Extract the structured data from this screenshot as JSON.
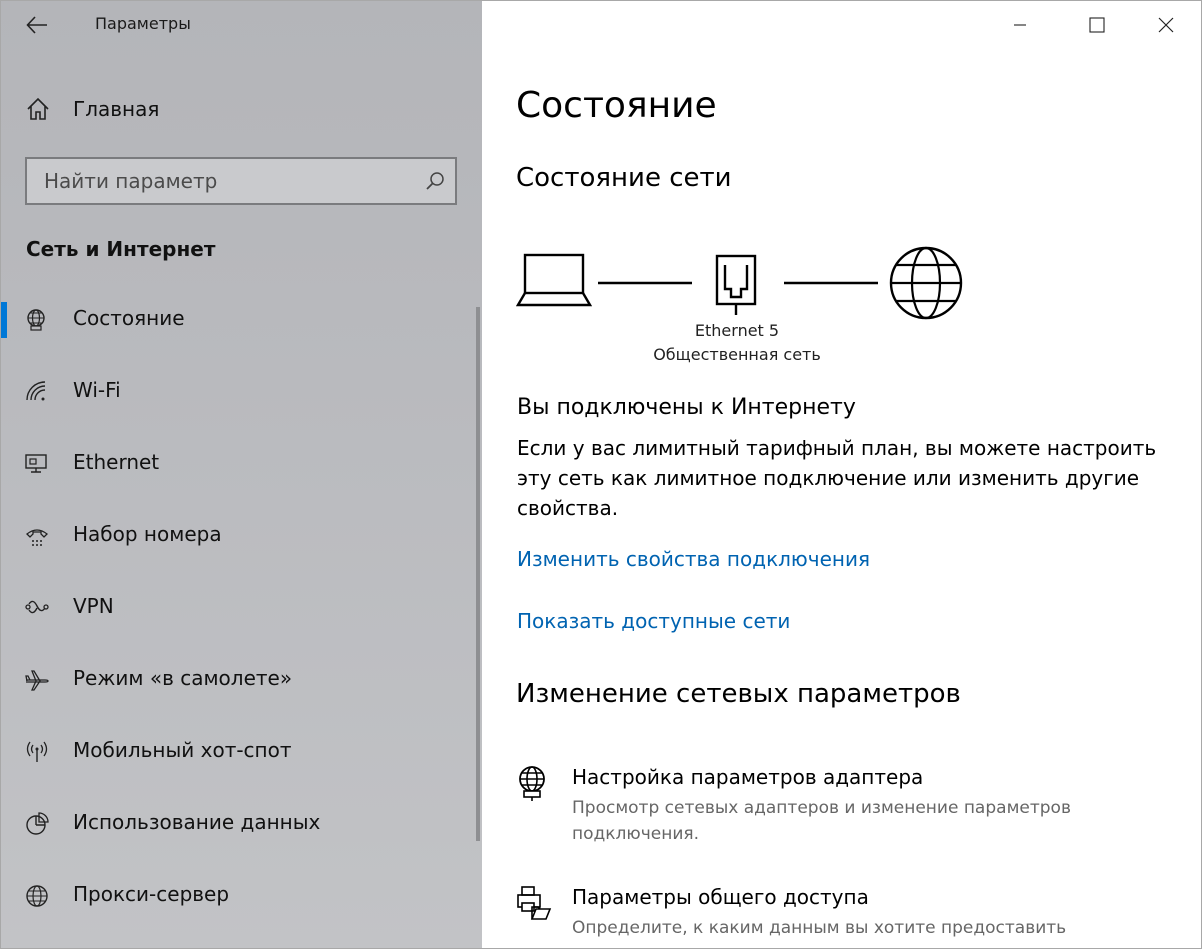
{
  "window": {
    "title": "Параметры",
    "minimize_icon": "minimize-icon",
    "maximize_icon": "maximize-icon",
    "close_icon": "close-icon"
  },
  "sidebar": {
    "home_label": "Главная",
    "search_placeholder": "Найти параметр",
    "section_title": "Сеть и Интернет",
    "items": [
      {
        "label": "Состояние",
        "icon": "status-globe-icon",
        "active": true
      },
      {
        "label": "Wi-Fi",
        "icon": "wifi-icon"
      },
      {
        "label": "Ethernet",
        "icon": "ethernet-icon"
      },
      {
        "label": "Набор номера",
        "icon": "dialup-icon"
      },
      {
        "label": "VPN",
        "icon": "vpn-icon"
      },
      {
        "label": "Режим «в самолете»",
        "icon": "airplane-icon"
      },
      {
        "label": "Мобильный хот-спот",
        "icon": "hotspot-icon"
      },
      {
        "label": "Использование данных",
        "icon": "data-usage-icon"
      },
      {
        "label": "Прокси-сервер",
        "icon": "proxy-globe-icon"
      }
    ]
  },
  "main": {
    "page_title": "Состояние",
    "network_status_heading": "Состояние сети",
    "network": {
      "adapter_name": "Ethernet 5",
      "network_type": "Общественная сеть"
    },
    "connected_heading": "Вы подключены к Интернету",
    "connected_description": "Если у вас лимитный тарифный план, вы можете настроить эту сеть как лимитное подключение или изменить другие свойства.",
    "link_change_properties": "Изменить свойства подключения",
    "link_show_networks": "Показать доступные сети",
    "change_settings_heading": "Изменение сетевых параметров",
    "options": [
      {
        "title": "Настройка параметров адаптера",
        "subtitle": "Просмотр сетевых адаптеров и изменение параметров подключения."
      },
      {
        "title": "Параметры общего доступа",
        "subtitle": "Определите, к каким данным вы хотите предоставить доступ"
      }
    ]
  },
  "colors": {
    "accent": "#0078d7",
    "link": "#0063b1",
    "sidebar_bg": "#b9babe"
  }
}
